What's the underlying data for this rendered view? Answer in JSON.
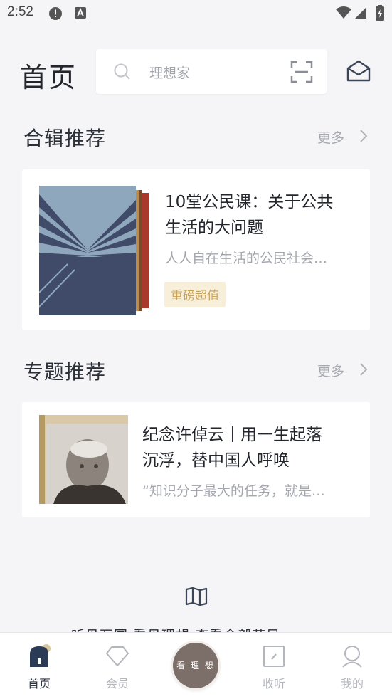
{
  "status_bar": {
    "time": "2:52"
  },
  "header": {
    "title": "首页",
    "search_placeholder": "理想家"
  },
  "collection_section": {
    "title": "合辑推荐",
    "more_label": "更多",
    "card": {
      "title_line1": "10堂公民课：关于公共",
      "title_line2": "生活的大问题",
      "subtitle": "人人自在生活的公民社会…",
      "badge": "重磅超值"
    }
  },
  "topic_section": {
    "title": "专题推荐",
    "more_label": "更多",
    "card": {
      "title_line1": "纪念许倬云｜用一生起落",
      "title_line2": "沉浮，替中国人呼唤",
      "subtitle": "“知识分子最大的任务，就是…"
    }
  },
  "footer_peek_text": "听见万国 看见理想 查看全部节目",
  "tabbar": {
    "tabs": [
      {
        "label": "首页",
        "icon": "home-icon",
        "active": true
      },
      {
        "label": "会员",
        "icon": "diamond-icon",
        "active": false
      },
      {
        "label": "看理想",
        "icon": "center-logo",
        "active": false
      },
      {
        "label": "收听",
        "icon": "listen-icon",
        "active": false
      },
      {
        "label": "我的",
        "icon": "profile-icon",
        "active": false
      }
    ],
    "center_label": "看 理 想"
  },
  "colors": {
    "accent": "#2b3442",
    "badge_bg": "#f7efd9",
    "badge_text": "#c7a25c",
    "center_button": "#7c6e68"
  }
}
